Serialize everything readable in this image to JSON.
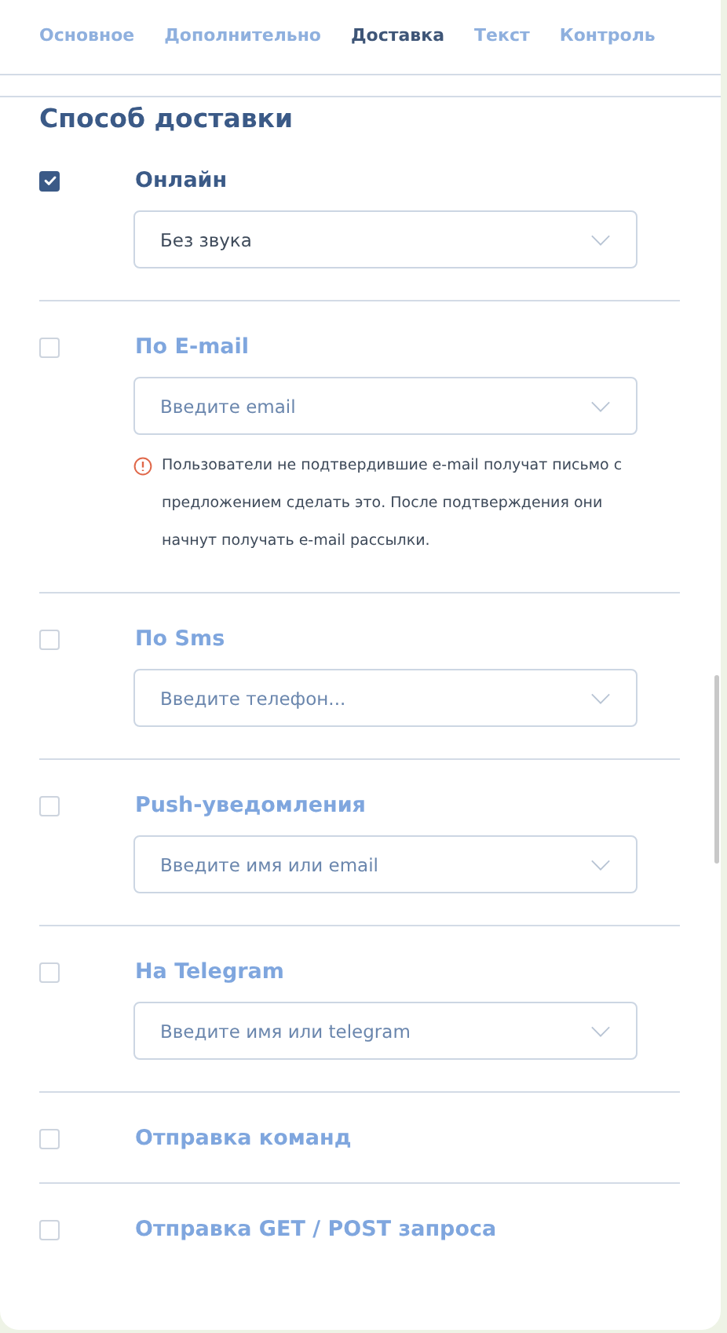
{
  "tabs": [
    {
      "label": "Основное",
      "selected": false
    },
    {
      "label": "Дополнительно",
      "selected": false
    },
    {
      "label": "Доставка",
      "selected": true
    },
    {
      "label": "Текст",
      "selected": false
    },
    {
      "label": "Контроль",
      "selected": false
    }
  ],
  "section": {
    "title": "Способ доставки"
  },
  "methods": [
    {
      "label": "Онлайн",
      "checked": true,
      "field": {
        "value": "Без звука"
      }
    },
    {
      "label": "По E-mail",
      "checked": false,
      "field": {
        "placeholder": "Введите email"
      },
      "note": "Пользователи не подтвердившие e-mail получат письмо с предложением сделать это. После подтверждения они начнут получать e-mail рассылки."
    },
    {
      "label": "По Sms",
      "checked": false,
      "field": {
        "placeholder": "Введите телефон..."
      }
    },
    {
      "label": "Push-уведомления",
      "checked": false,
      "field": {
        "placeholder": "Введите имя или email"
      }
    },
    {
      "label": "На Telegram",
      "checked": false,
      "field": {
        "placeholder": "Введите имя или telegram"
      }
    },
    {
      "label": "Отправка команд",
      "checked": false
    },
    {
      "label": "Отправка GET / POST запроса",
      "checked": false
    }
  ]
}
